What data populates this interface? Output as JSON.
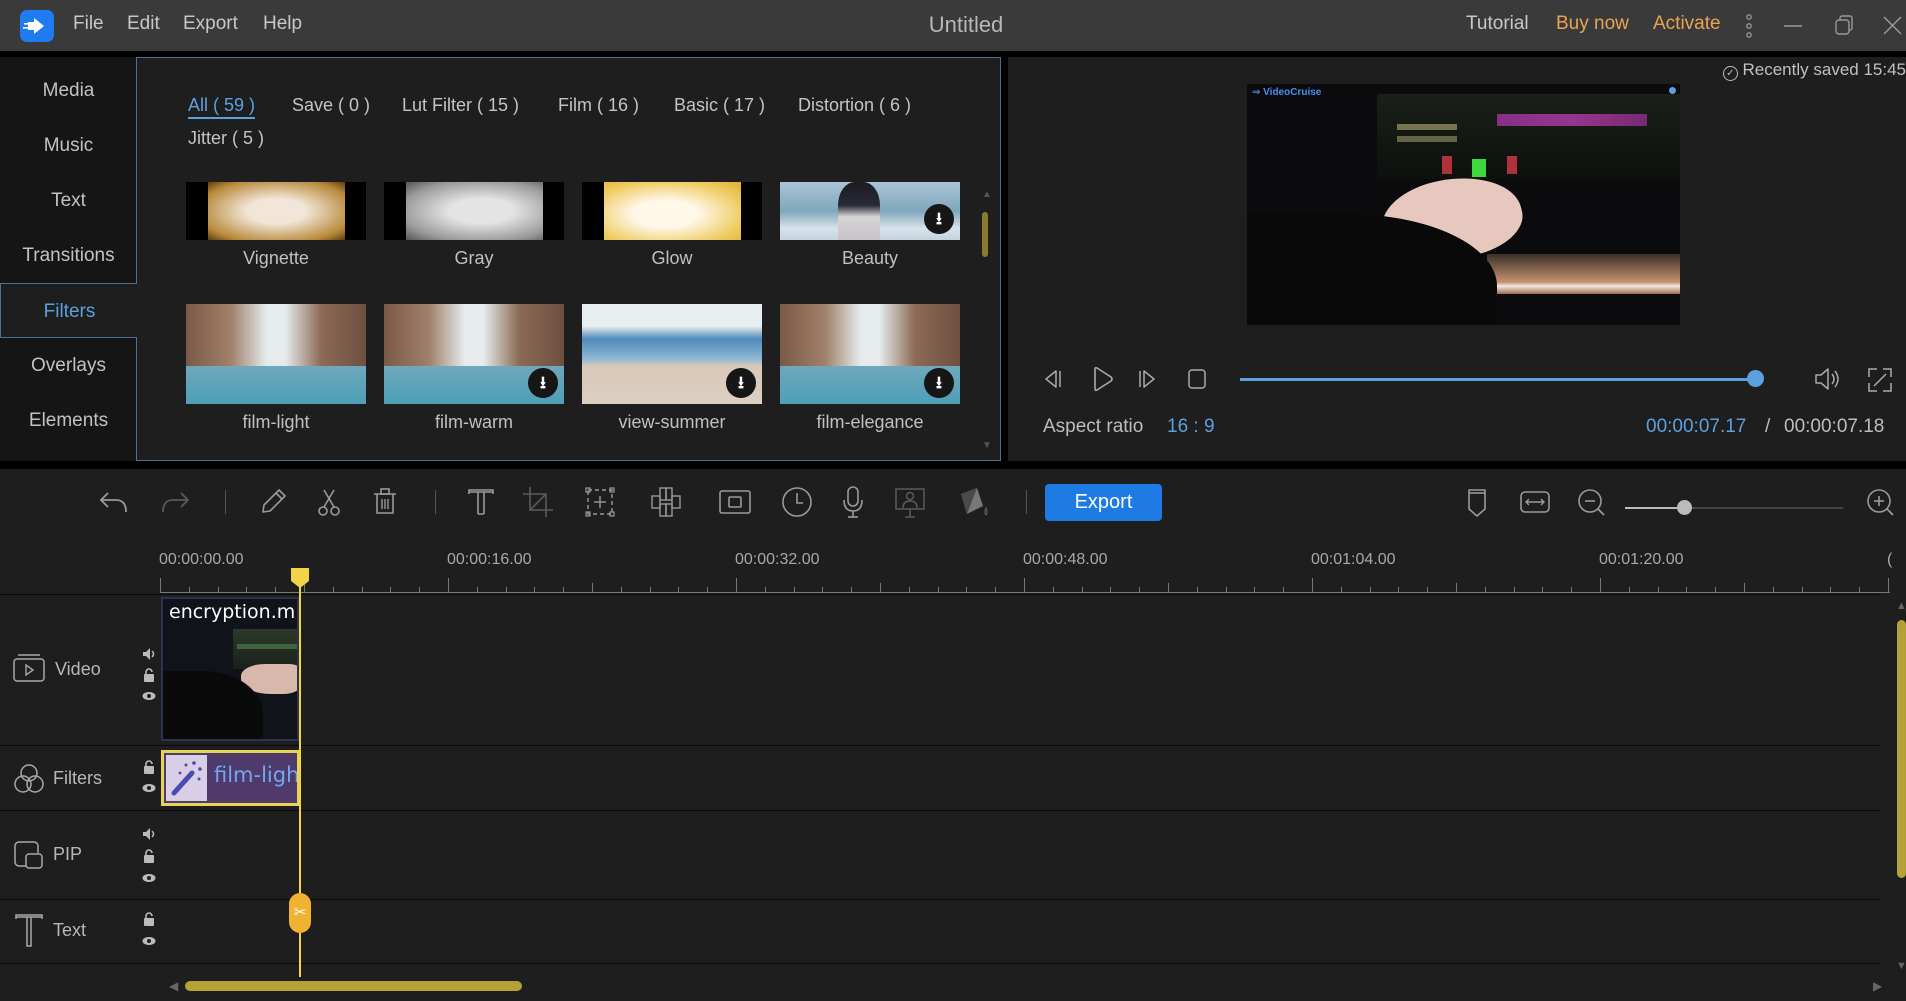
{
  "titlebar": {
    "menu": [
      "File",
      "Edit",
      "Export",
      "Help"
    ],
    "title": "Untitled",
    "tutorial": "Tutorial",
    "buy_now": "Buy now",
    "activate": "Activate"
  },
  "sidebar": {
    "items": [
      {
        "label": "Media"
      },
      {
        "label": "Music"
      },
      {
        "label": "Text"
      },
      {
        "label": "Transitions"
      },
      {
        "label": "Filters",
        "active": true
      },
      {
        "label": "Overlays"
      },
      {
        "label": "Elements"
      }
    ]
  },
  "filters": {
    "categories": [
      {
        "label": "All ( 59 )",
        "active": true
      },
      {
        "label": "Save ( 0 )"
      },
      {
        "label": "Lut Filter ( 15 )"
      },
      {
        "label": "Film ( 16 )"
      },
      {
        "label": "Basic ( 17 )"
      },
      {
        "label": "Distortion ( 6 )"
      },
      {
        "label": "Jitter ( 5 )"
      }
    ],
    "items": [
      {
        "name": "Vignette",
        "download": false
      },
      {
        "name": "Gray",
        "download": false
      },
      {
        "name": "Glow",
        "download": false
      },
      {
        "name": "Beauty",
        "download": true
      },
      {
        "name": "film-light",
        "download": false
      },
      {
        "name": "film-warm",
        "download": true
      },
      {
        "name": "view-summer",
        "download": true
      },
      {
        "name": "film-elegance",
        "download": true
      }
    ]
  },
  "preview": {
    "saved_status": "Recently saved 15:45",
    "watermark": "VideoCruise",
    "aspect_label": "Aspect ratio",
    "aspect_value": "16 : 9",
    "current_time": "00:00:07.17",
    "separator": "/",
    "total_time": "00:00:07.18",
    "progress_fraction": 0.99
  },
  "toolbar": {
    "export_label": "Export",
    "zoom_fraction": 0.27
  },
  "timeline": {
    "ruler": [
      "00:00:00.00",
      "00:00:16.00",
      "00:00:32.00",
      "00:00:48.00",
      "00:01:04.00",
      "00:01:20.00",
      "("
    ],
    "tracks": [
      {
        "name": "Video"
      },
      {
        "name": "Filters"
      },
      {
        "name": "PIP"
      },
      {
        "name": "Text"
      }
    ],
    "video_clip": "encryption.m",
    "filter_clip": "film-ligh"
  },
  "colors": {
    "accent_blue": "#5da0e0",
    "export_blue": "#1e7be3",
    "orange": "#e9a451",
    "playhead_yellow": "#f2d44b",
    "filter_clip_purple": "#4f3a6b"
  }
}
